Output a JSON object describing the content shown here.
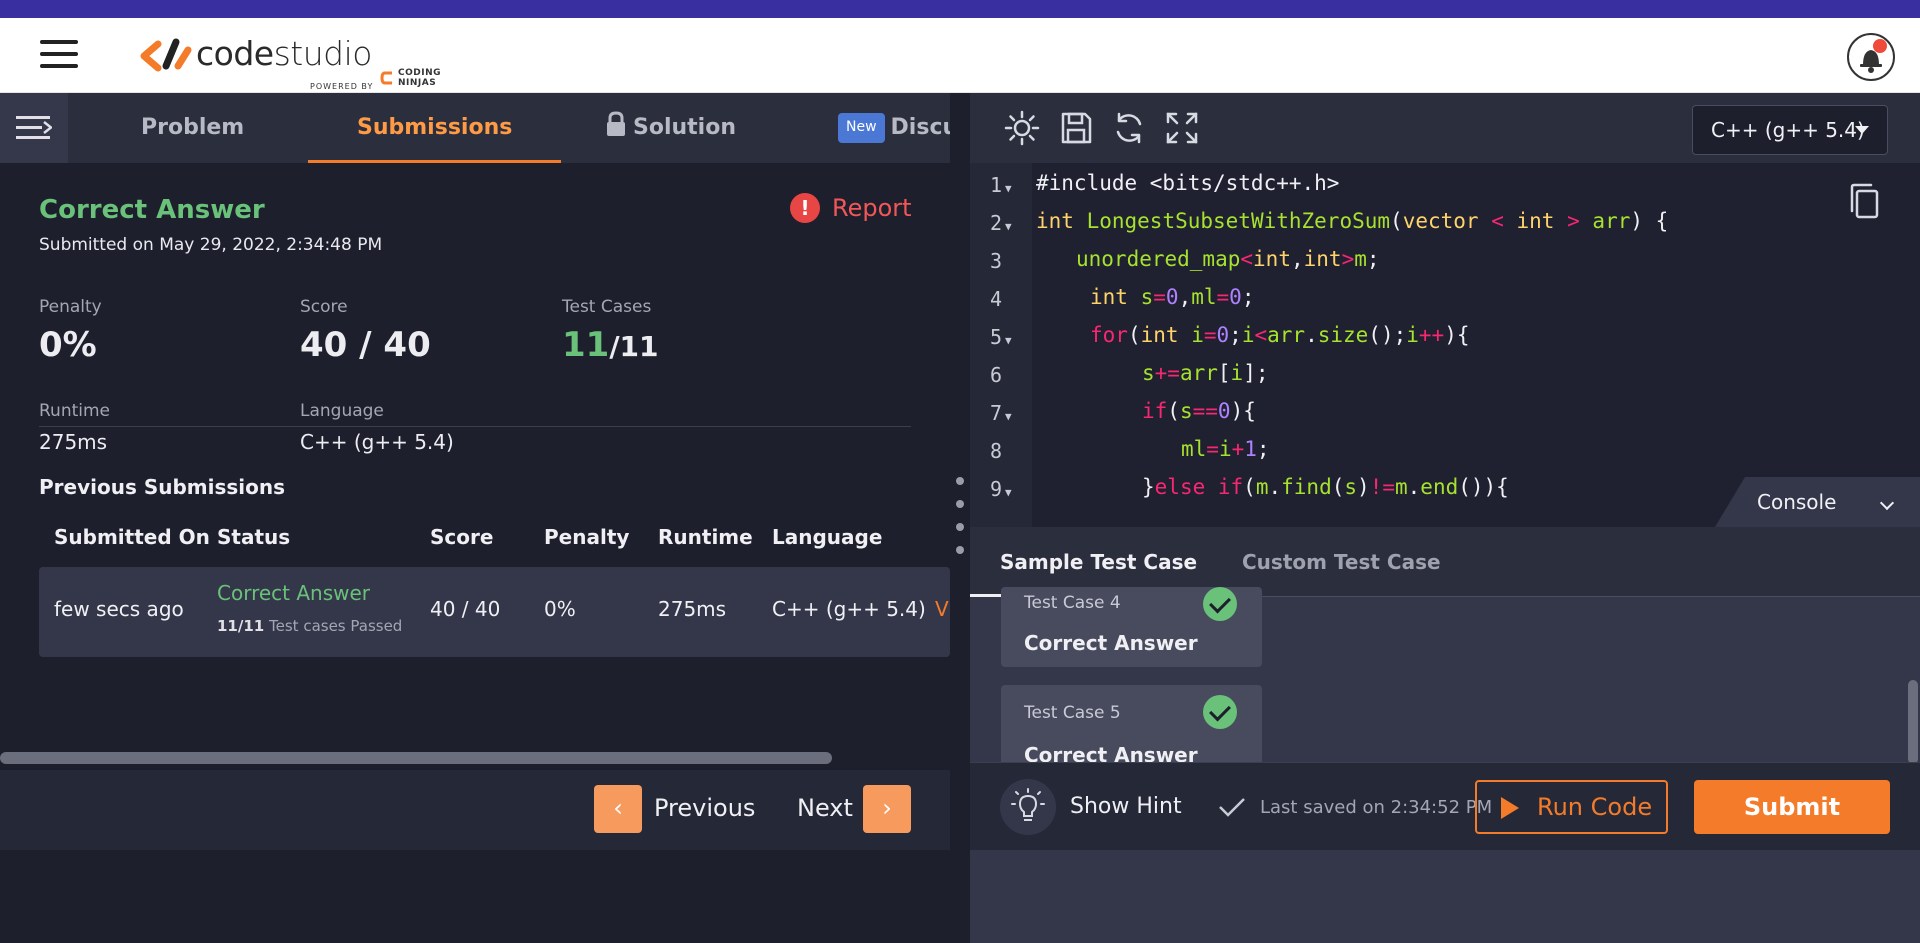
{
  "header": {
    "logo_text_code": "code",
    "logo_text_studio": "studio",
    "powered_by": "POWERED BY",
    "partner_line1": "CODING",
    "partner_line2": "NINJAS"
  },
  "left_tabs": {
    "problem": "Problem",
    "submissions": "Submissions",
    "solution": "Solution",
    "new_badge": "New",
    "discuss": "Discu"
  },
  "submission": {
    "verdict": "Correct Answer",
    "submitted_on": "Submitted on May 29, 2022, 2:34:48 PM",
    "report_label": "Report",
    "penalty_label": "Penalty",
    "penalty_value": "0%",
    "score_label": "Score",
    "score_value": "40 / 40",
    "testcases_label": "Test Cases",
    "testcases_passed": "11",
    "testcases_total": "/11",
    "runtime_label": "Runtime",
    "runtime_value": "275ms",
    "language_label": "Language",
    "language_value": "C++ (g++ 5.4)"
  },
  "previous": {
    "title": "Previous Submissions",
    "columns": [
      "Submitted On",
      "Status",
      "Score",
      "Penalty",
      "Runtime",
      "Language"
    ],
    "rows": [
      {
        "submitted_on": "few secs ago",
        "status": "Correct Answer",
        "passed": "11/11",
        "passed_suffix": "Test cases Passed",
        "score": "40 / 40",
        "penalty": "0%",
        "runtime": "275ms",
        "language": "C++ (g++ 5.4)",
        "view": "V"
      }
    ]
  },
  "pager": {
    "previous": "Previous",
    "next": "Next",
    "prev_arrow": "‹",
    "next_arrow": "›"
  },
  "editor": {
    "language": "C++ (g++ 5.4)",
    "line_numbers": [
      "1",
      "2",
      "3",
      "4",
      "5",
      "6",
      "7",
      "8",
      "9"
    ],
    "console_label": "Console"
  },
  "console": {
    "tab_sample": "Sample Test Case",
    "tab_custom": "Custom Test Case",
    "cases": [
      {
        "title": "Test Case 4",
        "result": "Correct Answer"
      },
      {
        "title": "Test Case 5",
        "result": "Correct Answer"
      }
    ]
  },
  "footer": {
    "show_hint": "Show Hint",
    "last_saved": "Last saved on 2:34:52 PM",
    "run_code": "Run Code",
    "submit": "Submit"
  },
  "colors": {
    "accent_orange": "#f37b2a",
    "success_green": "#6ac17a",
    "danger_red": "#e84545",
    "panel_bg": "#1d1f2c",
    "header_strip": "#3a2fa0"
  },
  "icons": {
    "menu": "hamburger-icon",
    "theme": "sun-icon",
    "save": "save-icon",
    "reset": "refresh-icon",
    "fullscreen": "expand-icon",
    "copy": "copy-icon",
    "lock": "lock-icon",
    "report": "alert-icon",
    "hint": "lightbulb-icon",
    "saved": "check-icon",
    "run": "play-icon",
    "notifications": "bell-icon"
  }
}
